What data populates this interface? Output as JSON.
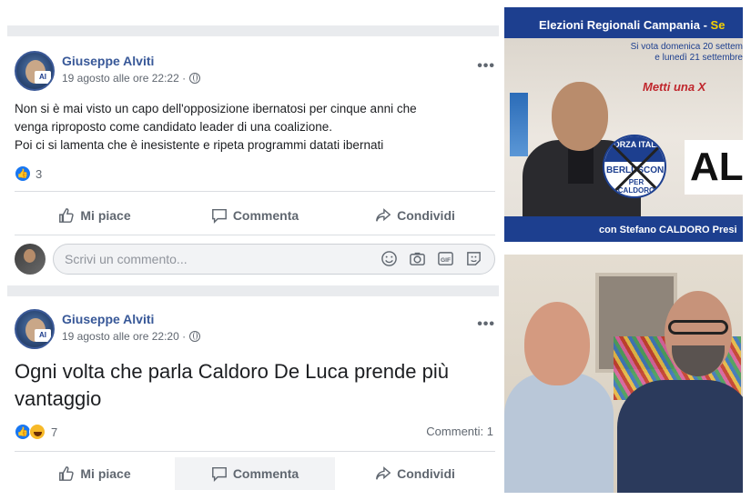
{
  "posts": [
    {
      "author": "Giuseppe Alviti",
      "timestamp": "19 agosto alle ore 22:22 ·",
      "text_lines": [
        "Non si è mai visto un capo dell'opposizione ibernatosi per cinque anni che",
        "venga riproposto come candidato leader di una coalizione.",
        "Poi ci si lamenta che è inesistente e ripeta programmi datati ibernati"
      ],
      "reaction_count": "3",
      "more_icon": "ellipsis-icon",
      "privacy_icon": "globe-icon"
    },
    {
      "author": "Giuseppe Alviti",
      "timestamp": "19 agosto alle ore 22:20 ·",
      "text": "Ogni volta che parla Caldoro De Luca prende più vantaggio",
      "reaction_count": "7",
      "comments_count": "Commenti: 1"
    }
  ],
  "actions": {
    "like": "Mi piace",
    "comment": "Commenta",
    "share": "Condividi"
  },
  "comment_box": {
    "placeholder": "Scrivi un commento...",
    "icons": [
      "emoji-icon",
      "camera-icon",
      "gif-icon",
      "sticker-icon"
    ]
  },
  "avatar_badge": "AI",
  "banner": {
    "title": "Elezioni Regionali Campania - ",
    "title_highlight": "Se",
    "subtitle_line1": "Si vota domenica 20 settem",
    "subtitle_line2": "e lunedì 21 settembre",
    "slogan": "Metti una X",
    "logo_top": "FORZA ITALIA",
    "logo_mid": "BERLUSCONI",
    "logo_low1": "PER",
    "logo_low2": "CALDORO",
    "name_partial": "AL",
    "footer": "con Stefano CALDORO Presi"
  },
  "colors": {
    "facebook_blue": "#385898",
    "like_blue": "#1877f2",
    "muted_text": "#606770",
    "banner_blue": "#1d3f8f",
    "banner_yellow": "#f5d000"
  }
}
